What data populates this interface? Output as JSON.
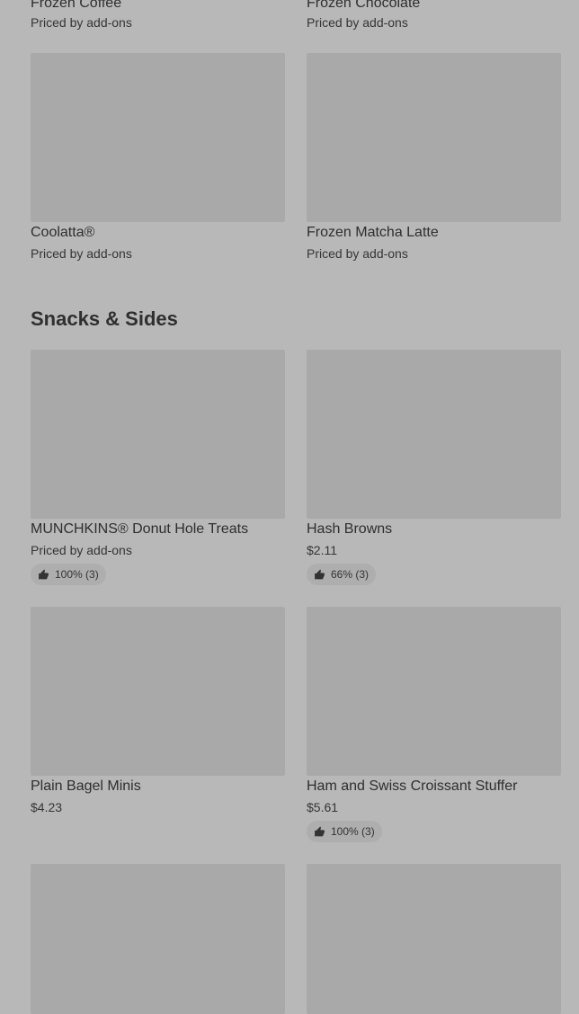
{
  "top_row": [
    {
      "name": "Frozen Coffee",
      "price": "Priced by add-ons"
    },
    {
      "name": "Frozen Chocolate",
      "price": "Priced by add-ons"
    }
  ],
  "beverages_row": [
    {
      "name": "Coolatta®",
      "price": "Priced by add-ons"
    },
    {
      "name": "Frozen Matcha Latte",
      "price": "Priced by add-ons"
    }
  ],
  "section": {
    "title": "Snacks & Sides"
  },
  "snacks": [
    {
      "name": "MUNCHKINS® Donut Hole Treats",
      "price": "Priced by add-ons",
      "rating": "100% (3)"
    },
    {
      "name": "Hash Browns",
      "price": "$2.11",
      "rating": "66% (3)"
    },
    {
      "name": "Plain Bagel Minis",
      "price": "$4.23"
    },
    {
      "name": "Ham and Swiss Croissant Stuffer",
      "price": "$5.61",
      "rating": "100% (3)"
    }
  ],
  "icons": {
    "rating": "thumbs-up-icon"
  },
  "colors": {
    "background": "#b8b8b8",
    "image_placeholder": "#a9a9a9",
    "rating_pill": "#aeaeae"
  }
}
